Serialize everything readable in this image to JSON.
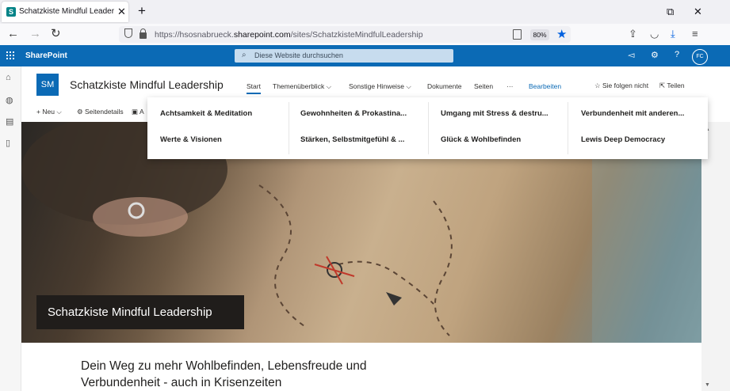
{
  "browser": {
    "tab_title": "Schatzkiste Mindful Leadership",
    "tab_favicon": "S",
    "url_prefix": "https://hsosnabrueck.",
    "url_domain": "sharepoint.com",
    "url_path": "/sites/SchatzkisteMindfulLeadership",
    "zoom": "80%",
    "icons": [
      "back-arrow-icon",
      "forward-arrow-icon",
      "reload-icon",
      "shield-icon",
      "lock-icon",
      "reader-icon",
      "star-icon",
      "extension-icon",
      "pocket-icon",
      "download-icon",
      "menu-icon"
    ]
  },
  "sharepoint": {
    "label": "SharePoint",
    "search_placeholder": "Diese Website durchsuchen",
    "avatar": "FC",
    "brand_color": "#0b6ab5"
  },
  "site": {
    "logo": "SM",
    "title": "Schatzkiste Mindful Leadership",
    "nav": {
      "start": "Start",
      "themen": "Themenüberblick",
      "hinweise": "Sonstige Hinweise",
      "dokumente": "Dokumente",
      "seiten": "Seiten",
      "more": "···",
      "bearbeiten": "Bearbeiten"
    },
    "follow": "Sie folgen nicht",
    "share": "Teilen"
  },
  "commands": {
    "new": "Neu",
    "details": "Seitendetails",
    "more": "A"
  },
  "megamenu": {
    "items": [
      "Achtsamkeit & Meditation",
      "Gewohnheiten & Prokastina...",
      "Umgang mit Stress & destru...",
      "Verbundenheit mit anderen...",
      "Werte & Visionen",
      "Stärken, Selbstmitgefühl & ...",
      "Glück & Wohlbefinden",
      "Lewis Deep Democracy"
    ]
  },
  "hero": {
    "title": "Schatzkiste Mindful Leadership"
  },
  "tagline": {
    "line1": "Dein Weg zu mehr Wohlbefinden, Lebensfreude und",
    "line2": "Verbundenheit - auch in Krisenzeiten"
  }
}
